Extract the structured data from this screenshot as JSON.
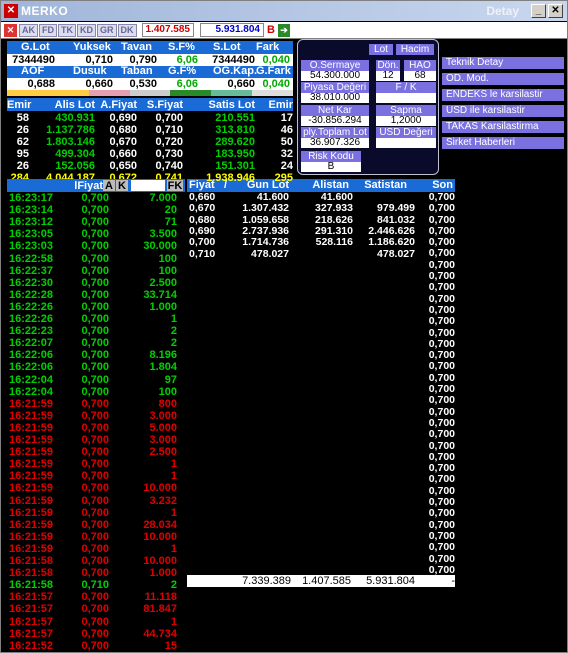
{
  "window": {
    "title": "MERKO",
    "subtitle": "Detay"
  },
  "toolbar": {
    "tabs": [
      "AK",
      "FD",
      "TK",
      "KD",
      "GR",
      "DK"
    ],
    "value_red": "1.407.585",
    "value_blue": "5.931.804",
    "b_label": "B"
  },
  "quote": {
    "row1_headers": [
      "G.Lot",
      "Yuksek",
      "Tavan",
      "S.F%",
      "S.Lot",
      "Fark"
    ],
    "row1_values": [
      "7344490",
      "0,710",
      "0,790",
      "6,06",
      "7344490",
      "0,040"
    ],
    "row2_headers": [
      "AOF",
      "Dusuk",
      "Taban",
      "G.F%",
      "OG.Kap.",
      "G.Fark"
    ],
    "row2_values": [
      "0,688",
      "0,660",
      "0,530",
      "6,06",
      "0,660",
      "0,040"
    ]
  },
  "orderbook": {
    "headers": [
      "Emir",
      "Alis Lot",
      "A.Fiyat",
      "S.Fiyat",
      "Satis Lot",
      "Emir"
    ],
    "rows": [
      [
        "58",
        "430.931",
        "0,690",
        "0,700",
        "210.551",
        "17"
      ],
      [
        "26",
        "1.137.786",
        "0,680",
        "0,710",
        "313.810",
        "46"
      ],
      [
        "62",
        "1.803.146",
        "0,670",
        "0,720",
        "289.620",
        "50"
      ],
      [
        "95",
        "499.304",
        "0,660",
        "0,730",
        "183.950",
        "32"
      ],
      [
        "26",
        "152.056",
        "0,650",
        "0,740",
        "151.301",
        "24"
      ]
    ],
    "totals": [
      "284",
      "4.044.187",
      "0,672",
      "0,741",
      "1.938.946",
      "295"
    ]
  },
  "trades": {
    "header_price": "lFiyat",
    "header_a": "A",
    "header_k": "K",
    "header_fk": "FK",
    "rows": [
      [
        "16:23:17",
        "0,700",
        "7.000",
        "g"
      ],
      [
        "16:23:14",
        "0,700",
        "20",
        "g"
      ],
      [
        "16:23:12",
        "0,700",
        "71",
        "g"
      ],
      [
        "16:23:05",
        "0,700",
        "3.500",
        "g"
      ],
      [
        "16:23:03",
        "0,700",
        "30.000",
        "g"
      ],
      [
        "16:22:58",
        "0,700",
        "100",
        "g"
      ],
      [
        "16:22:37",
        "0,700",
        "100",
        "g"
      ],
      [
        "16:22:30",
        "0,700",
        "2.500",
        "g"
      ],
      [
        "16:22:28",
        "0,700",
        "33.714",
        "g"
      ],
      [
        "16:22:26",
        "0,700",
        "1.000",
        "g"
      ],
      [
        "16:22:26",
        "0,700",
        "1",
        "g"
      ],
      [
        "16:22:23",
        "0,700",
        "2",
        "g"
      ],
      [
        "16:22:07",
        "0,700",
        "2",
        "g"
      ],
      [
        "16:22:06",
        "0,700",
        "8.196",
        "g"
      ],
      [
        "16:22:06",
        "0,700",
        "1.804",
        "g"
      ],
      [
        "16:22:04",
        "0,700",
        "97",
        "g"
      ],
      [
        "16:22:04",
        "0,700",
        "100",
        "g"
      ],
      [
        "16:21:59",
        "0,700",
        "800",
        "r"
      ],
      [
        "16:21:59",
        "0,700",
        "3.000",
        "r"
      ],
      [
        "16:21:59",
        "0,700",
        "5.000",
        "r"
      ],
      [
        "16:21:59",
        "0,700",
        "3.000",
        "r"
      ],
      [
        "16:21:59",
        "0,700",
        "2.500",
        "r"
      ],
      [
        "16:21:59",
        "0,700",
        "1",
        "r"
      ],
      [
        "16:21:59",
        "0,700",
        "1",
        "r"
      ],
      [
        "16:21:59",
        "0,700",
        "10.000",
        "r"
      ],
      [
        "16:21:59",
        "0,700",
        "3.232",
        "r"
      ],
      [
        "16:21:59",
        "0,700",
        "1",
        "r"
      ],
      [
        "16:21:59",
        "0,700",
        "28.034",
        "r"
      ],
      [
        "16:21:59",
        "0,700",
        "10.000",
        "r"
      ],
      [
        "16:21:59",
        "0,700",
        "1",
        "r"
      ],
      [
        "16:21:58",
        "0,700",
        "10.000",
        "r"
      ],
      [
        "16:21:58",
        "0,700",
        "1.000",
        "r"
      ],
      [
        "16:21:58",
        "0,710",
        "2",
        "g"
      ],
      [
        "16:21:57",
        "0,700",
        "11.118",
        "r"
      ],
      [
        "16:21:57",
        "0,700",
        "81.847",
        "r"
      ],
      [
        "16:21:57",
        "0,700",
        "1",
        "r"
      ],
      [
        "16:21:57",
        "0,700",
        "44.734",
        "r"
      ],
      [
        "16:21:52",
        "0,700",
        "15",
        "r"
      ]
    ]
  },
  "panel": {
    "btn_lot": "Lot",
    "btn_hacim": "Hacim",
    "osermaye_label": "O.Sermaye",
    "osermaye_value": "54.300.000",
    "don_label": "Dön.",
    "don_value": "12",
    "hao_label": "HAO",
    "hao_value": "68",
    "piyasa_label": "Piyasa Değeri",
    "piyasa_value": "38.010.000",
    "fk_label": "F / K",
    "fk_value": "",
    "netkar_label": "Net Kar",
    "netkar_value": "-30.856.294",
    "sapma_label": "Sapma",
    "sapma_value": "1,2000",
    "ply_label": "ply.Toplam Lot",
    "ply_value": "36.907.326",
    "usd_label": "USD Değeri",
    "usd_value": "",
    "risk_label": "Risk Kodu",
    "risk_value": "B"
  },
  "sidebuttons": [
    "Teknik Detay",
    "OD. Mod.",
    "ENDEKS le karsilastir",
    "USD ile karsilastir",
    "TAKAS Karsilastirma",
    "Sirket Haberleri"
  ],
  "depth": {
    "headers": [
      "Fiyat",
      "Gun Lot",
      "Alistan",
      "Satistan",
      "Son"
    ],
    "rows": [
      [
        "0,660",
        "41.600",
        "41.600",
        ""
      ],
      [
        "0,670",
        "1.307.432",
        "327.933",
        "979.499"
      ],
      [
        "0,680",
        "1.059.658",
        "218.626",
        "841.032"
      ],
      [
        "0,690",
        "2.737.936",
        "291.310",
        "2.446.626"
      ],
      [
        "0,700",
        "1.714.736",
        "528.116",
        "1.186.620"
      ],
      [
        "0,710",
        "478.027",
        "",
        "478.027"
      ]
    ],
    "son": [
      "0,700",
      "0,700",
      "0,700",
      "0,700",
      "0,700",
      "0,700",
      "0,700",
      "0,700",
      "0,700",
      "0,700",
      "0,700",
      "0,700",
      "0,700",
      "0,700",
      "0,700",
      "0,700",
      "0,700",
      "0,700",
      "0,700",
      "0,700",
      "0,700",
      "0,700",
      "0,700",
      "0,700",
      "0,700",
      "0,700",
      "0,700",
      "0,700",
      "0,700",
      "0,700",
      "0,700",
      "0,700",
      "0,700",
      "0,700",
      "0,700"
    ],
    "totals": [
      "7.339.389",
      "1.407.585",
      "5.931.804",
      "-"
    ]
  },
  "colors": {
    "header_blue": "#1a6bd6",
    "buy_green": "#00d000",
    "sell_red": "#e00000",
    "panel_purple": "#7b70e0"
  }
}
